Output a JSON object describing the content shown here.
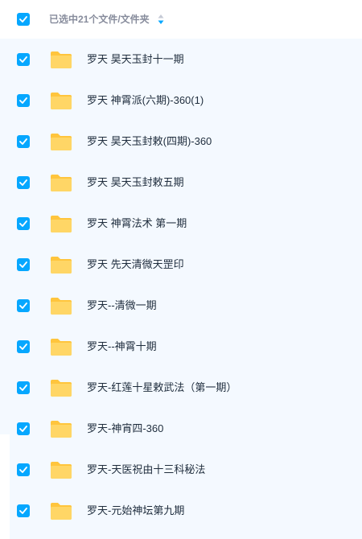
{
  "header": {
    "select_all_icon": "checkbox-checked",
    "label": "已选中21个文件/文件夹",
    "sort_icon": "sort-arrows-icon"
  },
  "colors": {
    "accent": "#06a7ff",
    "list_background": "#f4f9ff",
    "folder_yellow": "#ffc53d",
    "text": "#1f2d3d",
    "header_text": "#878c9c"
  },
  "files": [
    {
      "name": "罗天 昊天玉封十一期",
      "type": "folder",
      "checked": true
    },
    {
      "name": "罗天 神霄派(六期)-360(1)",
      "type": "folder",
      "checked": true
    },
    {
      "name": "罗天 昊天玉封敕(四期)-360",
      "type": "folder",
      "checked": true
    },
    {
      "name": "罗天 昊天玉封敕五期",
      "type": "folder",
      "checked": true
    },
    {
      "name": "罗天 神霄法术 第一期",
      "type": "folder",
      "checked": true
    },
    {
      "name": "罗天 先天清微天罡印",
      "type": "folder",
      "checked": true
    },
    {
      "name": "罗天--清微一期",
      "type": "folder",
      "checked": true
    },
    {
      "name": "罗天--神霄十期",
      "type": "folder",
      "checked": true
    },
    {
      "name": "罗天-红莲十星敕武法（第一期）",
      "type": "folder",
      "checked": true
    },
    {
      "name": "罗天-神宵四-360",
      "type": "folder",
      "checked": true
    },
    {
      "name": "罗天-天医祝由十三科秘法",
      "type": "folder",
      "checked": true
    },
    {
      "name": "罗天-元始神坛第九期",
      "type": "folder",
      "checked": true
    }
  ]
}
